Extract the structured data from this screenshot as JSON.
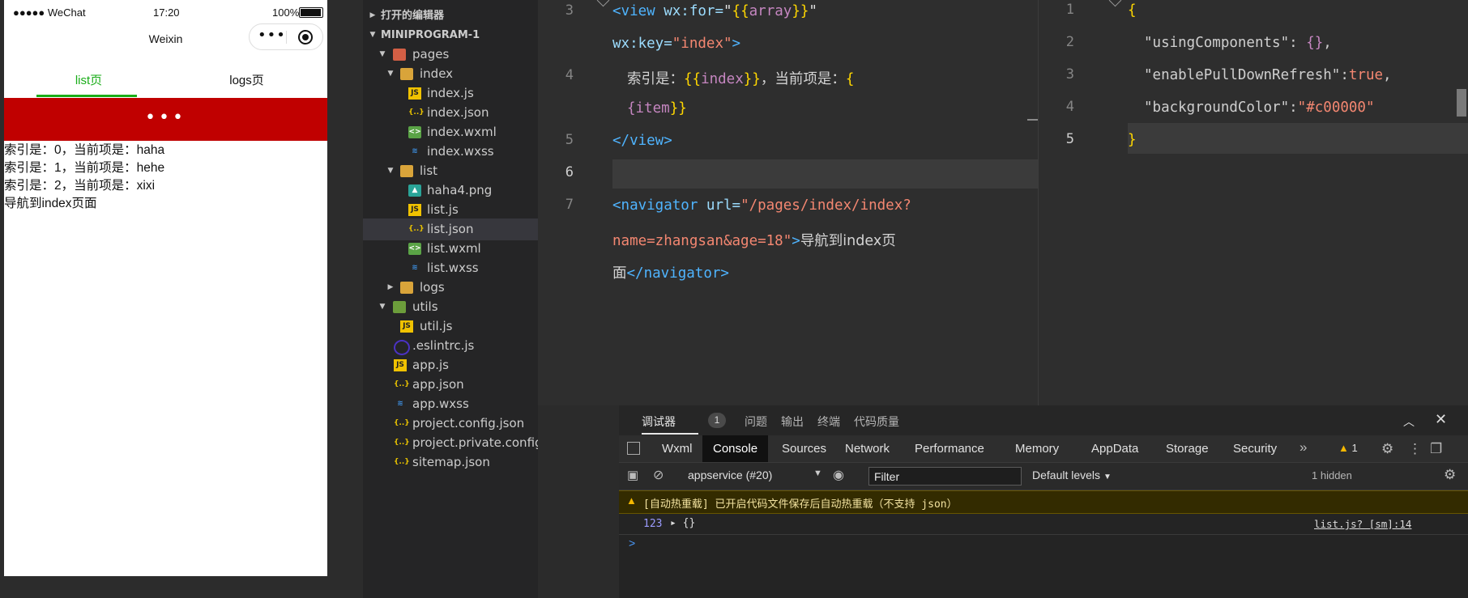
{
  "phone": {
    "status": {
      "signal": "●●●●● WeChat",
      "time": "17:20",
      "battery": "100%"
    },
    "nav_title": "Weixin",
    "capsule_dots": "•••",
    "tabs": [
      {
        "label": "list页"
      },
      {
        "label": "logs页"
      }
    ],
    "refresh_dots": "•••",
    "lines": [
      "索引是：0，当前项是：haha",
      "索引是：1，当前项是：hehe",
      "索引是：2，当前项是：xixi",
      "导航到index页面"
    ]
  },
  "explorer": {
    "open_editors": "打开的编辑器",
    "project": "MINIPROGRAM-1",
    "rows": [
      {
        "label": "pages"
      },
      {
        "label": "index"
      },
      {
        "label": "index.js"
      },
      {
        "label": "index.json"
      },
      {
        "label": "index.wxml"
      },
      {
        "label": "index.wxss"
      },
      {
        "label": "list"
      },
      {
        "label": "haha4.png"
      },
      {
        "label": "list.js"
      },
      {
        "label": "list.json"
      },
      {
        "label": "list.wxml"
      },
      {
        "label": "list.wxss"
      },
      {
        "label": "logs"
      },
      {
        "label": "utils"
      },
      {
        "label": "util.js"
      },
      {
        "label": ".eslintrc.js"
      },
      {
        "label": "app.js"
      },
      {
        "label": "app.json"
      },
      {
        "label": "app.wxss"
      },
      {
        "label": "project.config.json"
      },
      {
        "label": "project.private.config.js..."
      },
      {
        "label": "sitemap.json"
      }
    ]
  },
  "editor_left": {
    "line_numbers": [
      "3",
      "4",
      "5",
      "6",
      "7"
    ],
    "t": {
      "view_open": "<view",
      "wxfor": "wx:for=",
      "q": "\"",
      "lbrace": "{{",
      "array": "array",
      "rbrace": "}}",
      "wxkey": "wx:key=",
      "index_str": "\"index\"",
      "gt": ">",
      "txt1": "索引是：",
      "index_var": "index",
      "txt2": "，当前项是：",
      "lone_brace": "{",
      "item_open": "{item",
      "view_close": "</view>",
      "nav_open": "<navigator",
      "url_attr": "url=",
      "url_val1": "\"/pages/index/index?",
      "url_val2": "name=zhangsan&age=18\"",
      "nav_txt1": "导航到index页",
      "nav_txt2": "面",
      "nav_close": "</navigator>"
    }
  },
  "editor_right": {
    "line_numbers": [
      "1",
      "2",
      "3",
      "4",
      "5"
    ],
    "t": {
      "open": "{",
      "k1": "\"usingComponents\"",
      "colon": ": ",
      "v1": "{}",
      "comma": ",",
      "k2": "\"enablePullDownRefresh\"",
      "colon2": ":",
      "v2": "true",
      "k3": "\"backgroundColor\"",
      "v3": "\"#c00000\"",
      "close": "}"
    }
  },
  "devtools": {
    "top_tabs": [
      "调试器",
      "问题",
      "输出",
      "终端",
      "代码质量"
    ],
    "badge": "1",
    "tabs": [
      "Wxml",
      "Console",
      "Sources",
      "Network",
      "Performance",
      "Memory",
      "AppData",
      "Storage",
      "Security"
    ],
    "more": "»",
    "warn_count": "1",
    "context": "appservice (#20)",
    "filter_placeholder": "Filter",
    "levels": "Default levels",
    "hidden": "1 hidden",
    "warning": "[自动热重载] 已开启代码文件保存后自动热重载（不支持 json）",
    "log_line_no": "123",
    "log_obj": "▸ {}",
    "log_source": "list.js? [sm]:14",
    "prompt": ">"
  }
}
